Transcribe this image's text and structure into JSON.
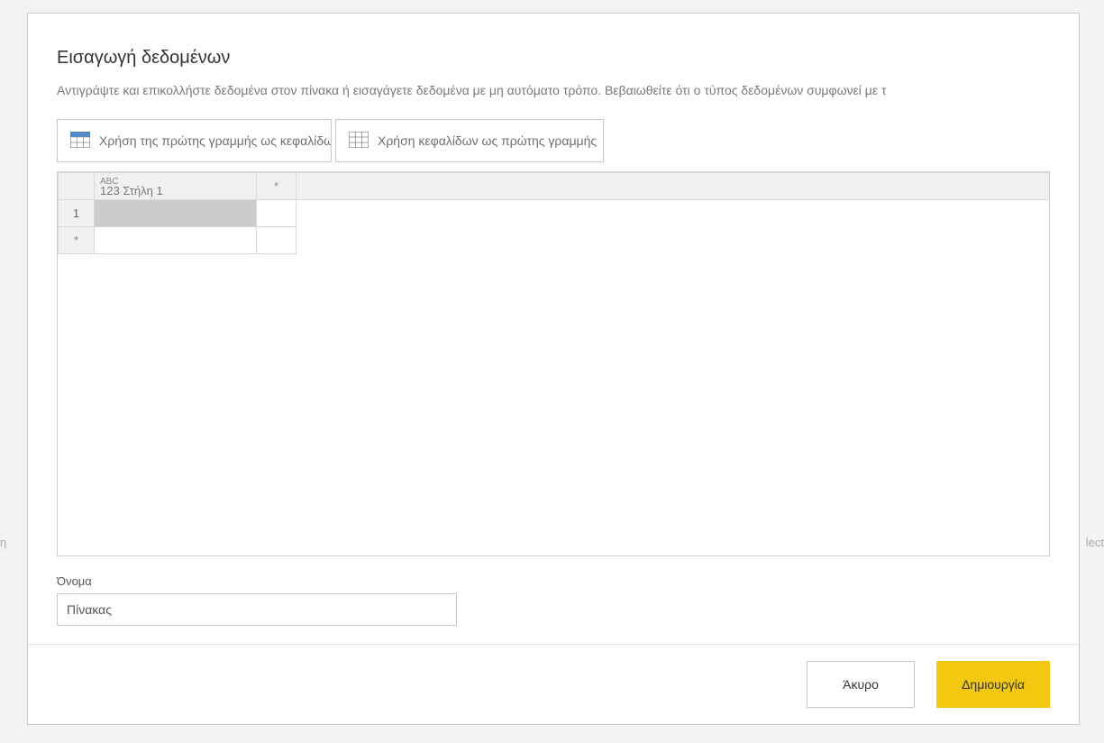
{
  "dialog": {
    "title": "Εισαγωγή δεδομένων",
    "subtitle": "Αντιγράψτε και επικολλήστε δεδομένα στον πίνακα ή εισαγάγετε δεδομένα με μη αυτόματο τρόπο. Βεβαιωθείτε ότι ο τύπος δεδομένων συμφωνεί με τ"
  },
  "toolbar": {
    "use_first_row_as_headers": "Χρήση της πρώτης γραμμής ως κεφαλίδων",
    "use_headers_as_first_row": "Χρήση κεφαλίδων ως πρώτης γραμμής"
  },
  "grid": {
    "column_type_label": "ABC",
    "column_type_sub": "123",
    "column_name": "Στήλη 1",
    "add_column_symbol": "*",
    "row_1_number": "1",
    "add_row_symbol": "*"
  },
  "name_field": {
    "label": "Όνομα",
    "value": "Πίνακας"
  },
  "footer": {
    "cancel": "Άκυρο",
    "create": "Δημιουργία"
  }
}
